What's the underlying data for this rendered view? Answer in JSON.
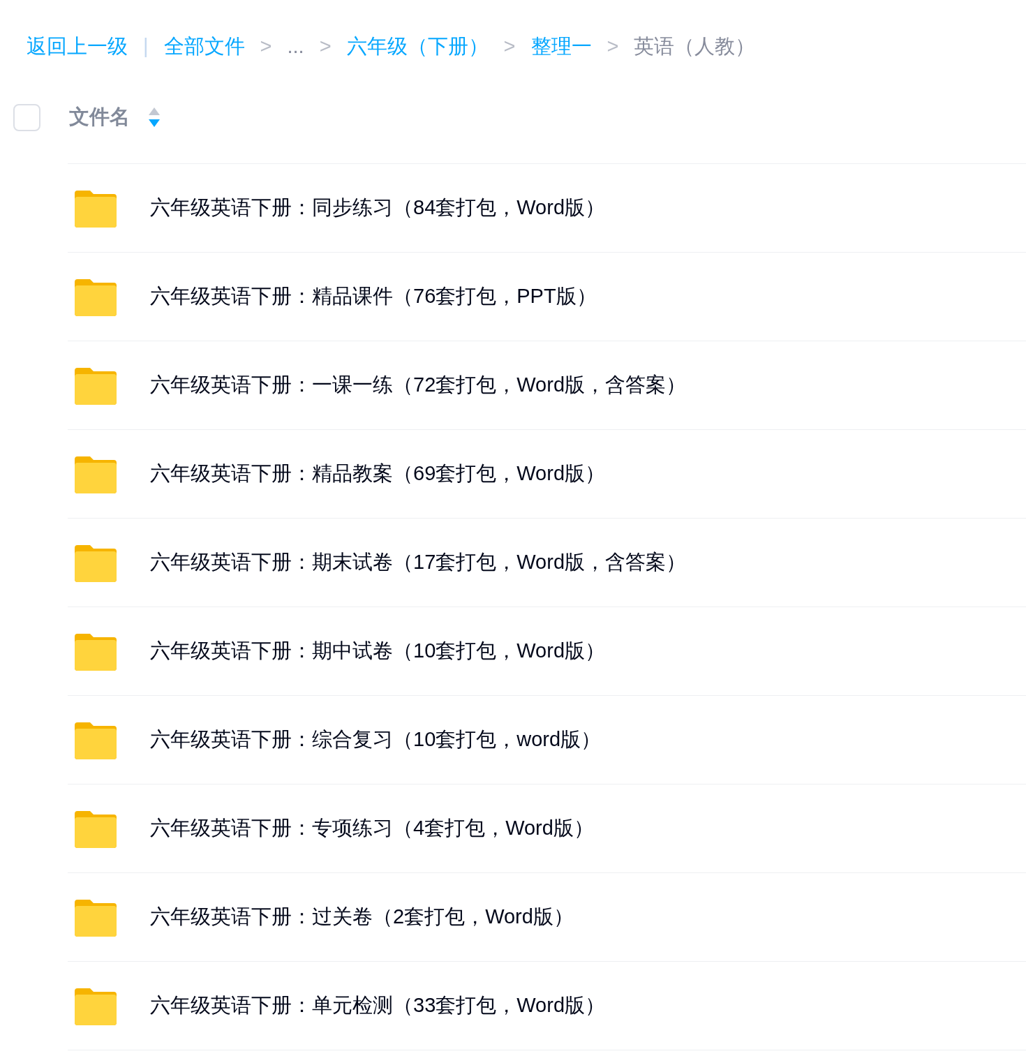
{
  "breadcrumb": {
    "back": "返回上一级",
    "divider": "|",
    "items": [
      {
        "label": "全部文件",
        "kind": "link"
      },
      {
        "separator": ">",
        "label": "...",
        "kind": "ellipsis"
      },
      {
        "separator": ">",
        "label": "六年级（下册）",
        "kind": "link"
      },
      {
        "separator": ">",
        "label": "整理一",
        "kind": "link"
      },
      {
        "separator": ">",
        "label": "英语（人教）",
        "kind": "current"
      }
    ]
  },
  "header": {
    "select_all_checked": false,
    "column": "文件名",
    "sort_descending": true
  },
  "files": [
    {
      "name": "六年级英语下册：同步练习（84套打包，Word版）",
      "kind": "folder"
    },
    {
      "name": "六年级英语下册：精品课件（76套打包，PPT版）",
      "kind": "folder"
    },
    {
      "name": "六年级英语下册：一课一练（72套打包，Word版，含答案）",
      "kind": "folder"
    },
    {
      "name": "六年级英语下册：精品教案（69套打包，Word版）",
      "kind": "folder"
    },
    {
      "name": "六年级英语下册：期末试卷（17套打包，Word版，含答案）",
      "kind": "folder"
    },
    {
      "name": "六年级英语下册：期中试卷（10套打包，Word版）",
      "kind": "folder"
    },
    {
      "name": "六年级英语下册：综合复习（10套打包，word版）",
      "kind": "folder"
    },
    {
      "name": "六年级英语下册：专项练习（4套打包，Word版）",
      "kind": "folder"
    },
    {
      "name": "六年级英语下册：过关卷（2套打包，Word版）",
      "kind": "folder"
    },
    {
      "name": "六年级英语下册：单元检测（33套打包，Word版）",
      "kind": "folder"
    }
  ]
}
